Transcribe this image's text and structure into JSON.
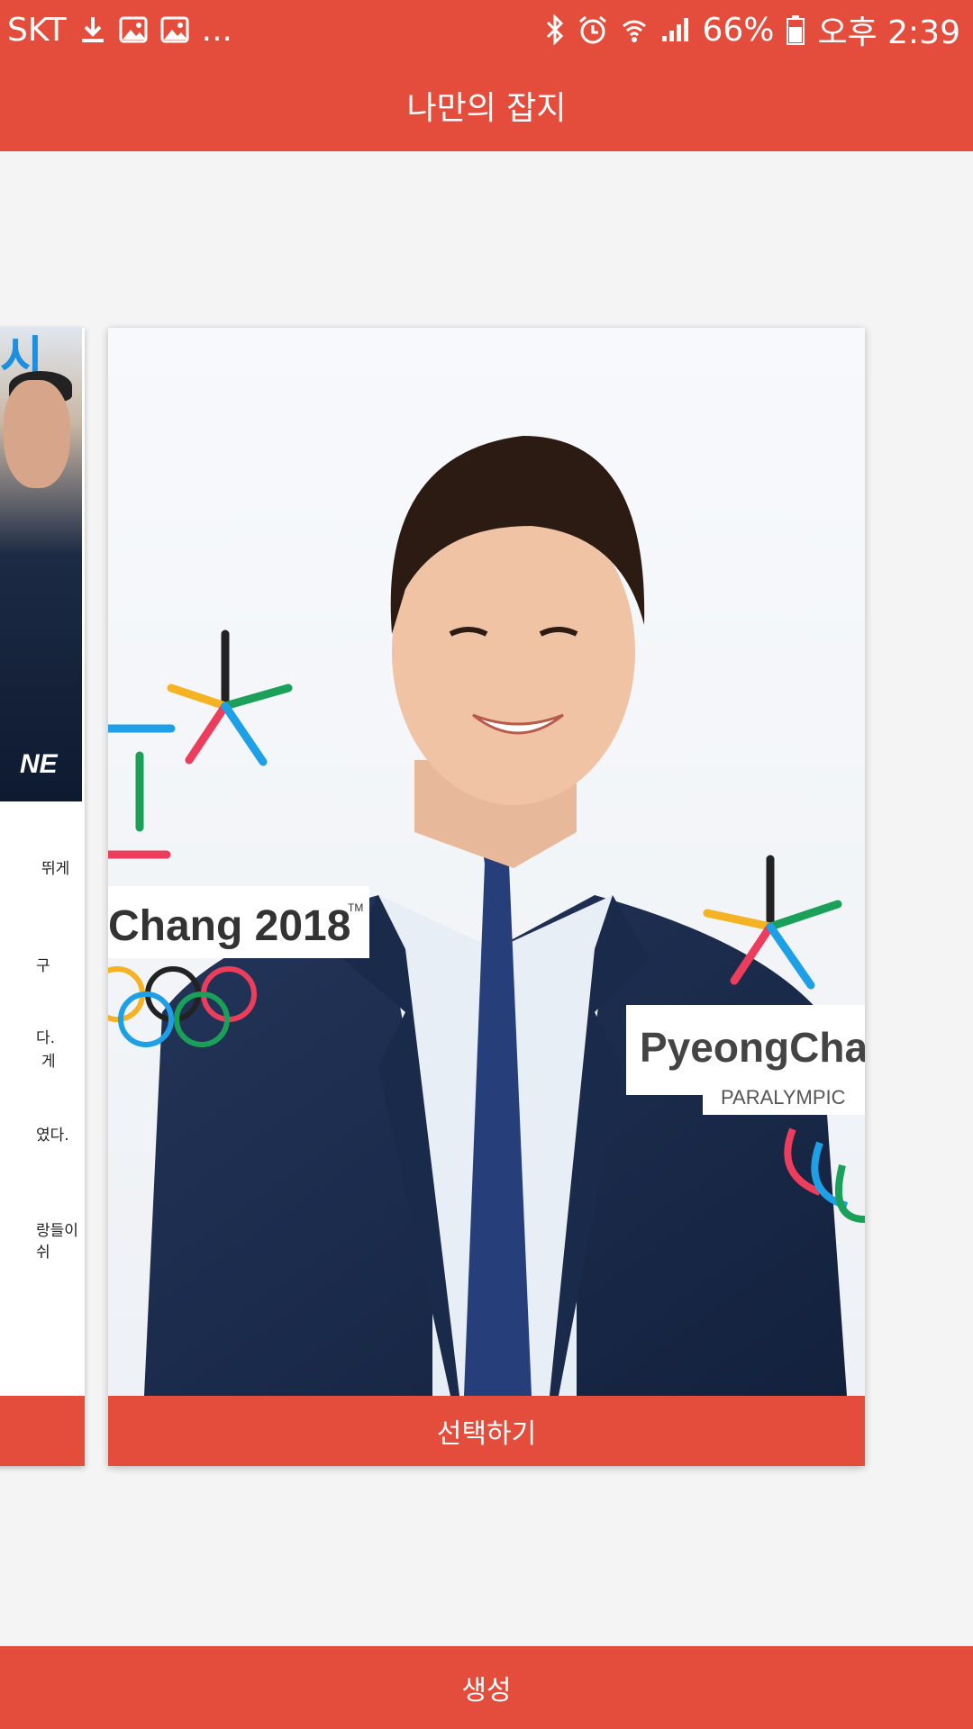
{
  "status_bar": {
    "carrier": "SKT",
    "more": "...",
    "battery": "66%",
    "time": "오후 2:39"
  },
  "app_bar": {
    "title": "나만의 잡지"
  },
  "cards": {
    "prev": {
      "photo_text": "NE",
      "photo_top_text": "시",
      "text_fragments": [
        "뛰게",
        "구",
        "다.",
        "게",
        "였다.",
        "랑들이",
        "쉬"
      ]
    },
    "main": {
      "photo_text_left": "Chang 2018",
      "photo_tm": "TM",
      "photo_text_right": "PyeongCha",
      "photo_text_right_sub": "PARALYMPIC",
      "select_label": "선택하기"
    }
  },
  "bottom": {
    "create_label": "생성"
  },
  "colors": {
    "accent": "#e44c3b",
    "background": "#f4f4f4"
  }
}
